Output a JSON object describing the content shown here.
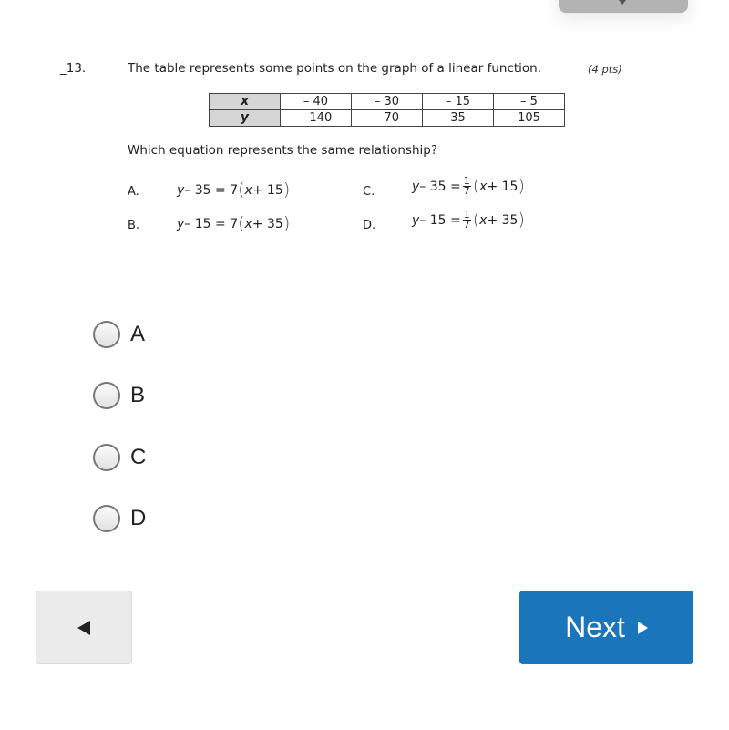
{
  "question": {
    "number": "_13.",
    "prompt": "The table represents some points on the graph of a linear function.",
    "points": "(4 pts)",
    "table": {
      "row_headers": [
        "x",
        "y"
      ],
      "x_values": [
        "– 40",
        "– 30",
        "– 15",
        "– 5"
      ],
      "y_values": [
        "– 140",
        "– 70",
        "35",
        "105"
      ]
    },
    "sub_question": "Which equation represents the same relationship?",
    "options": [
      {
        "letter": "A.",
        "lhs_var": "y",
        "lhs_rest": " – 35 = 7",
        "rhs_var": "x",
        "rhs_rest": " + 15",
        "fraction": null
      },
      {
        "letter": "B.",
        "lhs_var": "y",
        "lhs_rest": " – 15 = 7",
        "rhs_var": "x",
        "rhs_rest": " + 35",
        "fraction": null
      },
      {
        "letter": "C.",
        "lhs_var": "y",
        "lhs_rest": " – 35 = ",
        "rhs_var": "x",
        "rhs_rest": " + 15",
        "fraction": {
          "num": "1",
          "den": "7"
        }
      },
      {
        "letter": "D.",
        "lhs_var": "y",
        "lhs_rest": " – 15 = ",
        "rhs_var": "x",
        "rhs_rest": " + 35",
        "fraction": {
          "num": "1",
          "den": "7"
        }
      }
    ]
  },
  "answers": [
    {
      "label": "A",
      "selected": false
    },
    {
      "label": "B",
      "selected": false
    },
    {
      "label": "C",
      "selected": false
    },
    {
      "label": "D",
      "selected": false
    }
  ],
  "nav": {
    "back_icon": "triangle-left-icon",
    "next_label": "Next",
    "next_icon": "triangle-right-icon",
    "next_color": "#1a75bb",
    "top_tab_icon": "caret-down-icon"
  },
  "parens": {
    "open": "(",
    "close": ")"
  }
}
